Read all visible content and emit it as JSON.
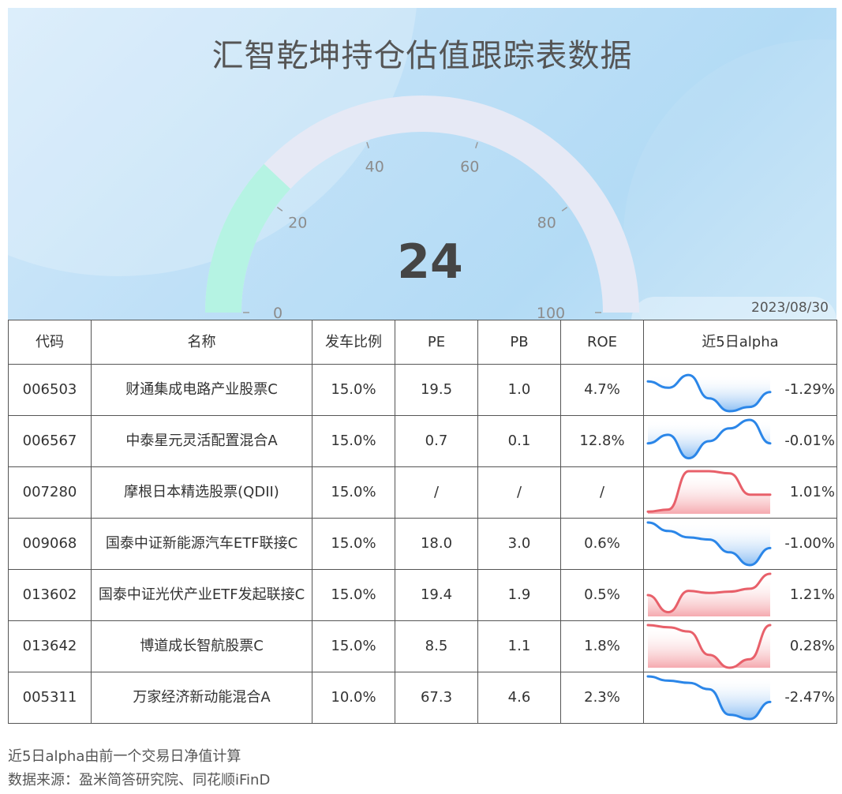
{
  "header": {
    "title": "汇智乾坤持仓估值跟踪表数据",
    "date": "2023/08/30"
  },
  "gauge": {
    "value": 24,
    "value_label": "24",
    "min": 0,
    "max": 100,
    "ticks": [
      "0",
      "20",
      "40",
      "60",
      "80",
      "100"
    ],
    "fill_color": "#b5f3e3",
    "track_color": "#e6e9f5"
  },
  "table": {
    "headers": {
      "code": "代码",
      "name": "名称",
      "ratio": "发车比例",
      "pe": "PE",
      "pb": "PB",
      "roe": "ROE",
      "alpha": "近5日alpha"
    },
    "rows": [
      {
        "code": "006503",
        "name": "财通集成电路产业股票C",
        "ratio": "15.0%",
        "pe": "19.5",
        "pb": "1.0",
        "roe": "4.7%",
        "alpha": "-1.29%",
        "trend": [
          0.3,
          0.45,
          0.15,
          0.7,
          1.0,
          0.9,
          0.55
        ]
      },
      {
        "code": "006567",
        "name": "中泰星元灵活配置混合A",
        "ratio": "15.0%",
        "pe": "0.7",
        "pb": "0.1",
        "roe": "12.8%",
        "alpha": "-0.01%",
        "trend": [
          0.55,
          0.35,
          0.9,
          0.5,
          0.2,
          0.0,
          0.55
        ]
      },
      {
        "code": "007280",
        "name": "摩根日本精选股票(QDII)",
        "ratio": "15.0%",
        "pe": "/",
        "pb": "/",
        "roe": "/",
        "alpha": "1.01%",
        "trend": [
          0.95,
          0.9,
          0.0,
          0.0,
          0.05,
          0.55,
          0.55
        ]
      },
      {
        "code": "009068",
        "name": "国泰中证新能源汽车ETF联接C",
        "ratio": "15.0%",
        "pe": "18.0",
        "pb": "3.0",
        "roe": "0.6%",
        "alpha": "-1.00%",
        "trend": [
          0.0,
          0.2,
          0.35,
          0.4,
          0.7,
          1.0,
          0.6
        ]
      },
      {
        "code": "013602",
        "name": "国泰中证光伏产业ETF发起联接C",
        "ratio": "15.0%",
        "pe": "19.4",
        "pb": "1.9",
        "roe": "0.5%",
        "alpha": "1.21%",
        "trend": [
          0.5,
          0.9,
          0.4,
          0.45,
          0.42,
          0.35,
          0.0
        ]
      },
      {
        "code": "013642",
        "name": "博道成长智航股票C",
        "ratio": "15.0%",
        "pe": "8.5",
        "pb": "1.1",
        "roe": "1.8%",
        "alpha": "0.28%",
        "trend": [
          0.0,
          0.05,
          0.15,
          0.7,
          1.0,
          0.8,
          0.0
        ]
      },
      {
        "code": "005311",
        "name": "万家经济新动能混合A",
        "ratio": "10.0%",
        "pe": "67.3",
        "pb": "4.6",
        "roe": "2.3%",
        "alpha": "-2.47%",
        "trend": [
          0.0,
          0.1,
          0.15,
          0.3,
          0.9,
          1.0,
          0.6
        ]
      }
    ]
  },
  "footer": {
    "note": "近5日alpha由前一个交易日净值计算",
    "source": "数据来源：盈米简答研究院、同花顺iFinD"
  },
  "colors": {
    "negative_line": "#2b86e8",
    "positive_line": "#e8606a",
    "negative_fill": "#7fb7f2",
    "positive_fill": "#f4a0a6"
  }
}
